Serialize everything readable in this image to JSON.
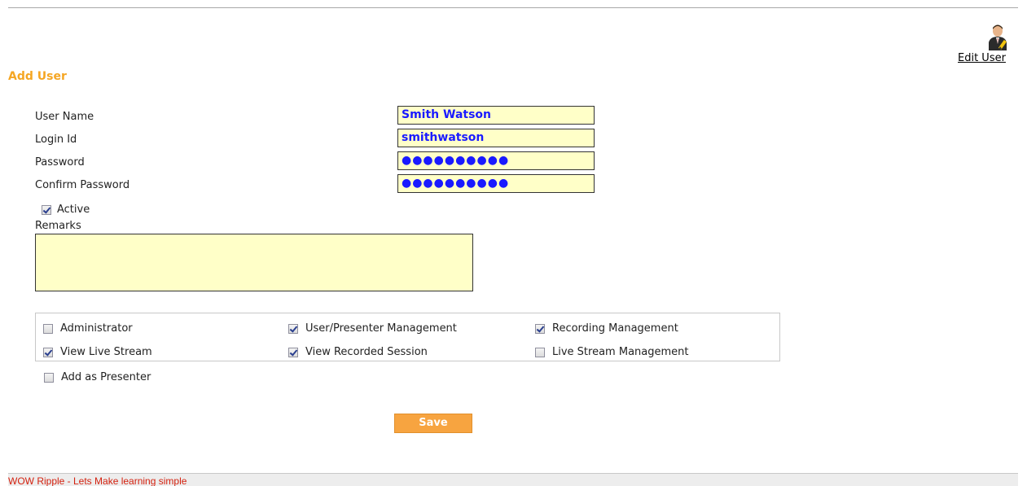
{
  "header": {
    "edit_user_label": "Edit User"
  },
  "page": {
    "title": "Add User"
  },
  "form": {
    "user_name_label": "User Name",
    "user_name_value": "Smith Watson",
    "login_id_label": "Login Id",
    "login_id_value": "smithwatson",
    "password_label": "Password",
    "password_value": "●●●●●●●●●●",
    "confirm_password_label": "Confirm Password",
    "confirm_password_value": "●●●●●●●●●●",
    "active_label": "Active",
    "active_checked": true,
    "remarks_label": "Remarks",
    "remarks_value": ""
  },
  "permissions": [
    {
      "label": "Administrator",
      "checked": false
    },
    {
      "label": "User/Presenter Management",
      "checked": true
    },
    {
      "label": "Recording Management",
      "checked": true
    },
    {
      "label": "View Live Stream",
      "checked": true
    },
    {
      "label": "View Recorded Session",
      "checked": true
    },
    {
      "label": "Live Stream Management",
      "checked": false
    }
  ],
  "presenter": {
    "label": "Add as Presenter",
    "checked": false
  },
  "actions": {
    "save_label": "Save"
  },
  "footer": {
    "text": "WOW Ripple - Lets Make learning simple"
  },
  "colors": {
    "accent": "#f5a623",
    "field_bg": "#ffffc8",
    "field_text": "#1a1aff",
    "footer_text": "#d4210f"
  },
  "icons": {
    "edit_user": "user-edit-icon"
  }
}
